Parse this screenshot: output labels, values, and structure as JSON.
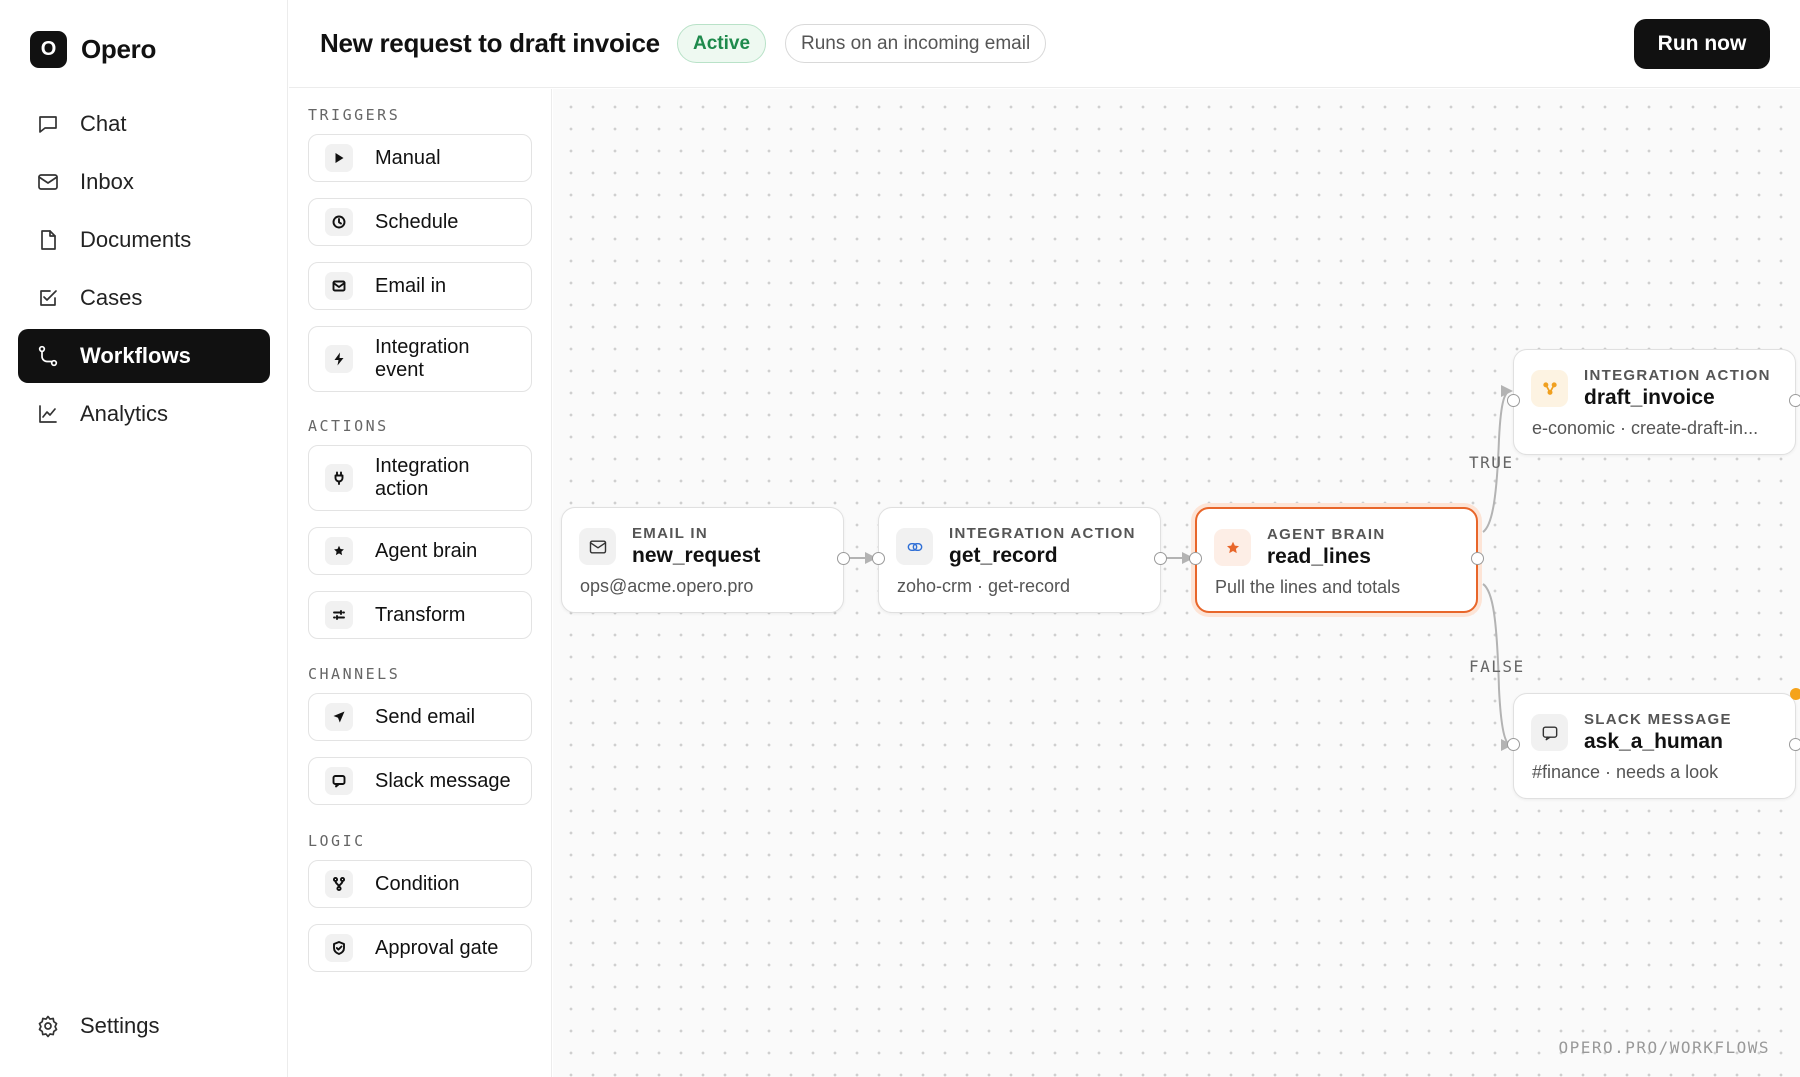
{
  "app": {
    "brand_initial": "O",
    "brand_name": "Opero"
  },
  "sidebar": {
    "items": [
      {
        "label": "Chat",
        "icon": "chat-icon"
      },
      {
        "label": "Inbox",
        "icon": "mail-icon"
      },
      {
        "label": "Documents",
        "icon": "document-icon"
      },
      {
        "label": "Cases",
        "icon": "checkbox-icon"
      },
      {
        "label": "Workflows",
        "icon": "workflow-icon",
        "active": true
      },
      {
        "label": "Analytics",
        "icon": "chart-icon"
      }
    ],
    "settings_label": "Settings"
  },
  "header": {
    "title": "New request to draft invoice",
    "status": "Active",
    "trigger_summary": "Runs on an incoming email",
    "run_label": "Run now"
  },
  "palette": {
    "triggers_label": "TRIGGERS",
    "triggers": [
      {
        "label": "Manual",
        "icon": "play-icon"
      },
      {
        "label": "Schedule",
        "icon": "clock-icon"
      },
      {
        "label": "Email in",
        "icon": "mail-icon"
      },
      {
        "label": "Integration event",
        "icon": "bolt-icon"
      }
    ],
    "actions_label": "ACTIONS",
    "actions": [
      {
        "label": "Integration action",
        "icon": "plug-icon"
      },
      {
        "label": "Agent brain",
        "icon": "star-icon"
      },
      {
        "label": "Transform",
        "icon": "transform-icon"
      }
    ],
    "channels_label": "CHANNELS",
    "channels": [
      {
        "label": "Send email",
        "icon": "send-icon"
      },
      {
        "label": "Slack message",
        "icon": "message-icon"
      }
    ],
    "logic_label": "LOGIC",
    "logic": [
      {
        "label": "Condition",
        "icon": "branch-icon"
      },
      {
        "label": "Approval gate",
        "icon": "shield-icon"
      }
    ]
  },
  "canvas": {
    "nodes": {
      "email_in": {
        "kind": "EMAIL IN",
        "name": "new_request",
        "sub": "ops@acme.opero.pro"
      },
      "get_record": {
        "kind": "INTEGRATION ACTION",
        "name": "get_record",
        "sub": "zoho-crm · get-record"
      },
      "read_lines": {
        "kind": "AGENT BRAIN",
        "name": "read_lines",
        "sub": "Pull the lines and totals"
      },
      "draft_invoice": {
        "kind": "INTEGRATION ACTION",
        "name": "draft_invoice",
        "sub": "e-conomic · create-draft-in..."
      },
      "ask_a_human": {
        "kind": "SLACK MESSAGE",
        "name": "ask_a_human",
        "sub": "#finance · needs a look"
      }
    },
    "branch_true": "TRUE",
    "branch_false": "FALSE",
    "watermark": "OPERO.PRO/WORKFLOWS"
  },
  "colors": {
    "accent": "#111111",
    "active_green": "#1e8a4c",
    "selected_orange": "#e8662a",
    "status_dot": "#f5a31a",
    "economic_orange": "#f0a020"
  }
}
